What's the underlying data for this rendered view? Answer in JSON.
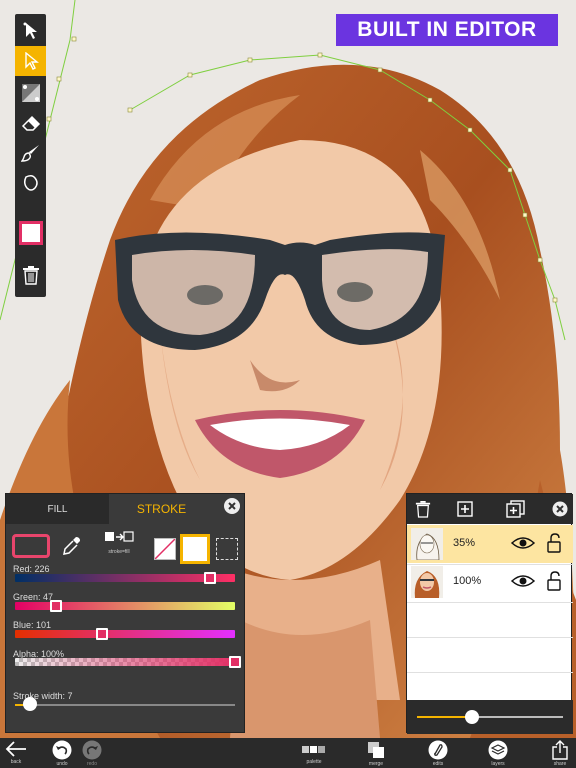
{
  "banner": {
    "text": "BUILT IN EDITOR"
  },
  "toolbar": {
    "tools": [
      {
        "icon": "arrow-select-icon",
        "active": false
      },
      {
        "icon": "node-select-icon",
        "active": true
      },
      {
        "icon": "gradient-icon",
        "active": false
      },
      {
        "icon": "eraser-icon",
        "active": false
      },
      {
        "icon": "brush-icon",
        "active": false
      },
      {
        "icon": "shape-icon",
        "active": false
      },
      {
        "icon": "color-swatch-icon",
        "active": false
      },
      {
        "icon": "trash-icon",
        "active": false
      }
    ]
  },
  "color_panel": {
    "tab_fill": "FILL",
    "tab_stroke": "STROKE",
    "swap_label": "stroke=fill",
    "red_label": "Red: 226",
    "red_value": 226,
    "green_label": "Green: 47",
    "green_value": 47,
    "blue_label": "Blue: 101",
    "blue_value": 101,
    "alpha_label": "Alpha: 100%",
    "alpha_value": 100,
    "stroke_width_label": "Stroke width: 7",
    "stroke_width_value": 7,
    "stroke_width_max": 100,
    "current_color": "#e22f65",
    "accent": "#f5b400"
  },
  "layers_panel": {
    "layers": [
      {
        "opacity_label": "35%",
        "active": true
      },
      {
        "opacity_label": "100%",
        "active": false
      }
    ],
    "opacity_slider": 0.38
  },
  "bottom_bar": {
    "back": "back",
    "undo": "undo",
    "redo": "redo",
    "palette": "palette",
    "merge": "merge",
    "edits": "edits",
    "layers": "layers",
    "share": "share"
  }
}
